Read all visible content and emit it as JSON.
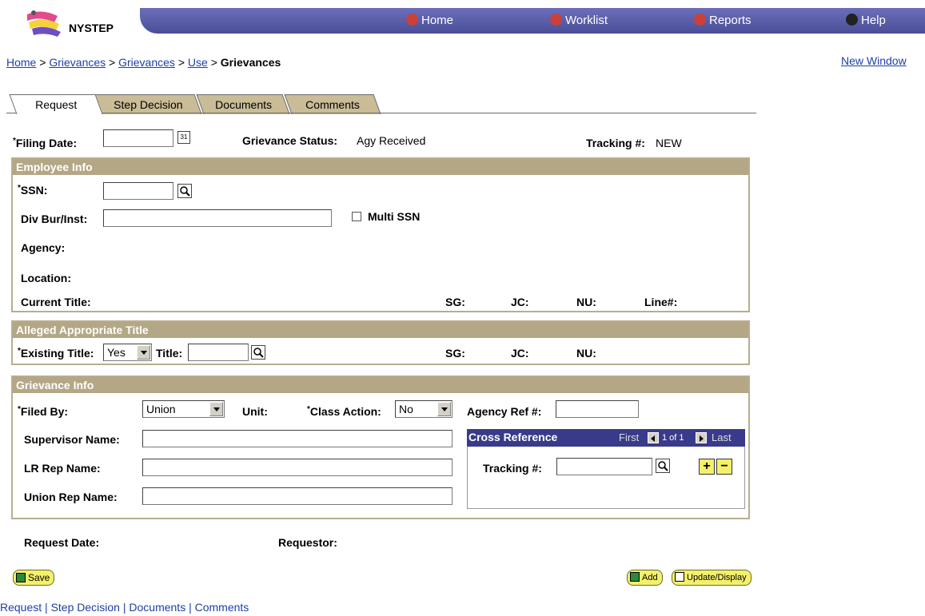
{
  "app": {
    "logo_text": "NYSTEP"
  },
  "nav": {
    "home": "Home",
    "worklist": "Worklist",
    "reports": "Reports",
    "help": "Help"
  },
  "breadcrumb": {
    "items": [
      "Home",
      "Grievances",
      "Grievances",
      "Use"
    ],
    "current": "Grievances",
    "separator": ">",
    "new_window": "New Window"
  },
  "tabs": [
    "Request",
    "Step Decision",
    "Documents",
    "Comments"
  ],
  "header_fields": {
    "filing_date_label": "Filing Date:",
    "filing_date_value": "",
    "status_label": "Grievance Status:",
    "status_value": "Agy Received",
    "tracking_label": "Tracking #:",
    "tracking_value": "NEW"
  },
  "employee_info": {
    "title": "Employee Info",
    "ssn_label": "SSN:",
    "ssn_value": "",
    "div_label": "Div Bur/Inst:",
    "div_value": "",
    "multi_ssn_label": "Multi SSN",
    "agency_label": "Agency:",
    "location_label": "Location:",
    "current_title_label": "Current Title:",
    "sg_label": "SG:",
    "jc_label": "JC:",
    "nu_label": "NU:",
    "line_label": "Line#:"
  },
  "alleged_title": {
    "title": "Alleged Appropriate Title",
    "existing_label": "Existing Title:",
    "existing_value": "Yes",
    "title_label": "Title:",
    "title_value": "",
    "sg_label": "SG:",
    "jc_label": "JC:",
    "nu_label": "NU:"
  },
  "grievance_info": {
    "title": "Grievance Info",
    "filed_by_label": "Filed By:",
    "filed_by_value": "Union",
    "unit_label": "Unit:",
    "class_action_label": "Class Action:",
    "class_action_value": "No",
    "agency_ref_label": "Agency Ref #:",
    "agency_ref_value": "",
    "supervisor_label": "Supervisor Name:",
    "lr_rep_label": "LR Rep Name:",
    "union_rep_label": "Union Rep Name:",
    "cross_ref": {
      "title": "Cross Reference",
      "first": "First",
      "count": "1 of 1",
      "last": "Last",
      "tracking_label": "Tracking #:",
      "tracking_value": ""
    }
  },
  "footer_fields": {
    "request_date_label": "Request Date:",
    "requestor_label": "Requestor:"
  },
  "buttons": {
    "save": "Save",
    "add": "Add",
    "update": "Update/Display"
  },
  "bottom_links": [
    "Request",
    "Step Decision",
    "Documents",
    "Comments"
  ],
  "colors": {
    "nav_bar": "#5a5da8",
    "group_header": "#b3a786",
    "cross_ref_header": "#3a3a8a",
    "link": "#1c3fa8",
    "button_yellow": "#f4f06a"
  }
}
